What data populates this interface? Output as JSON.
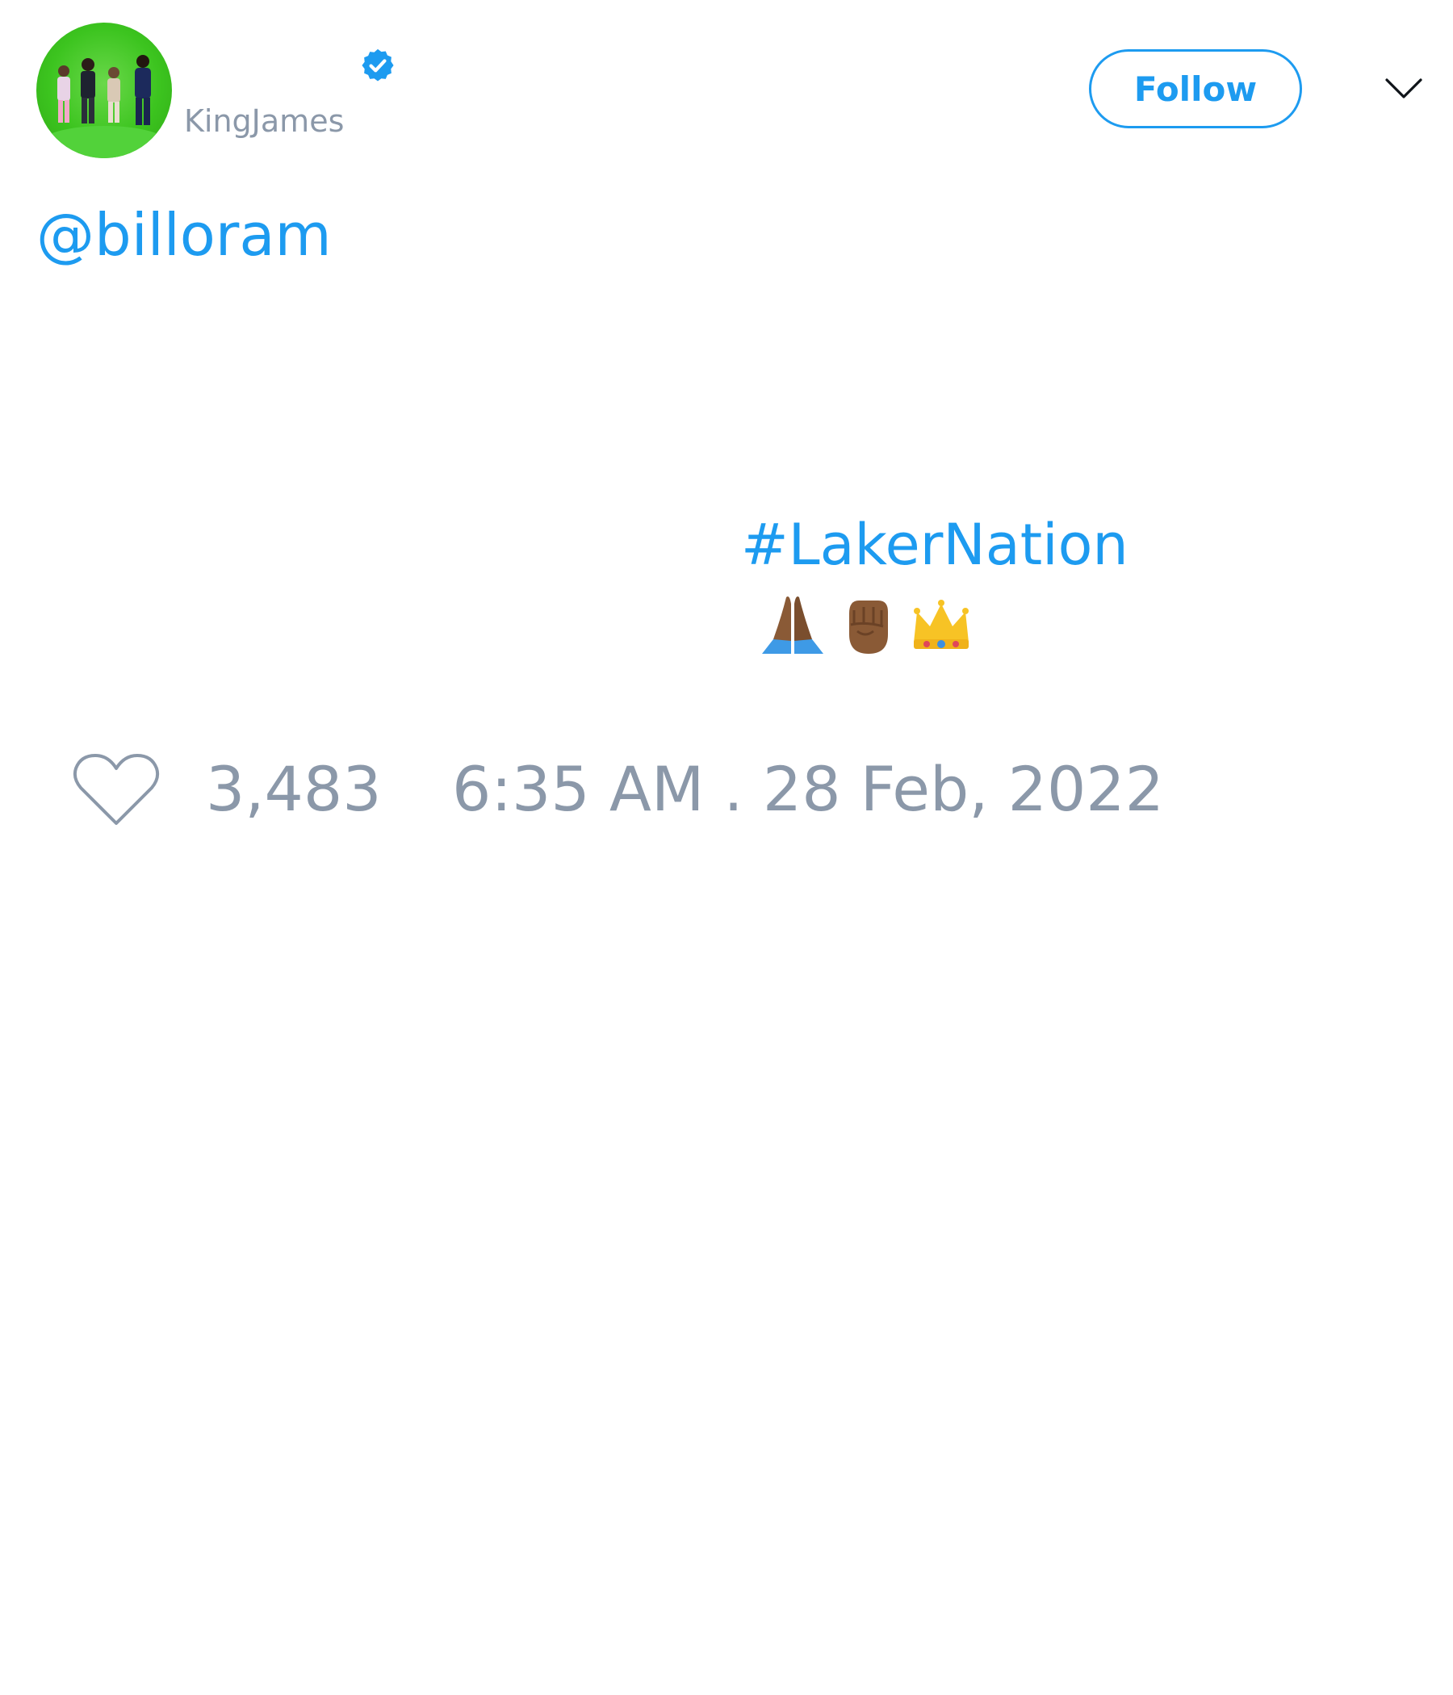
{
  "author": {
    "handle": "KingJames",
    "verified": true,
    "avatar_icon": "group-photo-avatar"
  },
  "header": {
    "follow_label": "Follow",
    "menu_icon": "chevron-down-icon"
  },
  "tweet": {
    "mention": "@billoram",
    "hashtag": "#LakerNation",
    "emojis": [
      "folded-hands",
      "raised-fist",
      "crown"
    ]
  },
  "footer": {
    "like_icon": "heart-outline-icon",
    "like_count": "3,483",
    "timestamp": "6:35 AM . 28 Feb, 2022"
  },
  "colors": {
    "accent": "#1d9bf0",
    "muted_text": "#8b98a9",
    "avatar_bg": "#3cc41f"
  }
}
